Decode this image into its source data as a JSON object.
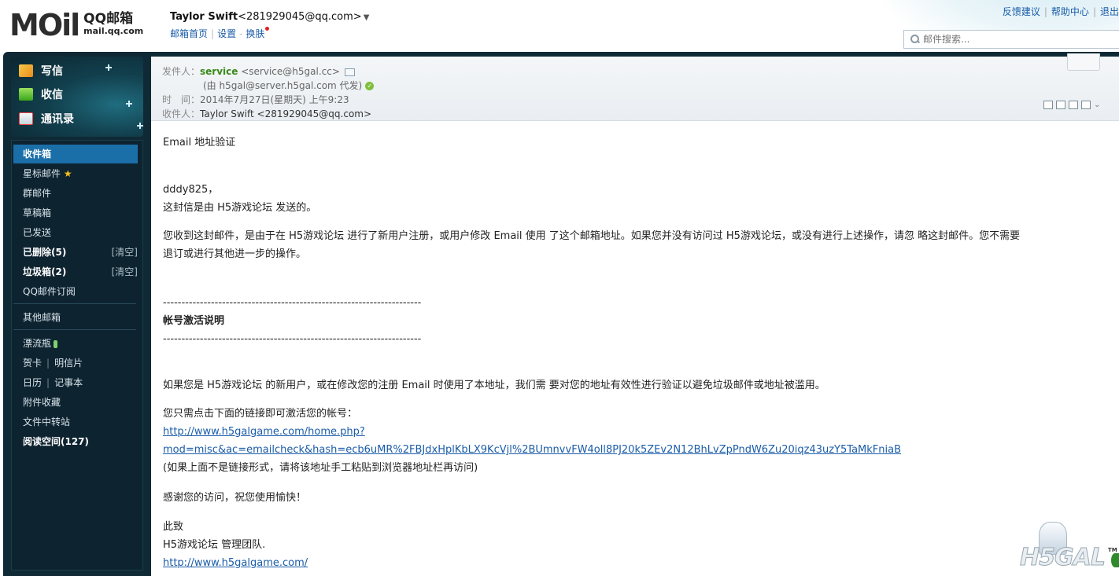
{
  "header": {
    "logo_mark": "MOil",
    "logo_cn": "QQ邮箱",
    "logo_url": "mail.qq.com",
    "user_name": "Taylor Swift",
    "user_email": "<281929045@qq.com>",
    "links": [
      "邮箱首页",
      "设置",
      "换肤"
    ],
    "top_links": [
      "反馈建议",
      "帮助中心",
      "退出"
    ],
    "search_placeholder": "邮件搜索..."
  },
  "quick_actions": [
    {
      "label": "写信",
      "icon": "pencil-icon"
    },
    {
      "label": "收信",
      "icon": "download-icon"
    },
    {
      "label": "通讯录",
      "icon": "contacts-icon"
    }
  ],
  "folders": {
    "inbox": "收件箱",
    "starred": "星标邮件",
    "star_glyph": "★",
    "group": "群邮件",
    "drafts": "草稿箱",
    "sent": "已发送",
    "deleted": "已删除(5)",
    "junk": "垃圾箱(2)",
    "clear": "[清空]",
    "subscription": "QQ邮件订阅",
    "other": "其他邮箱",
    "bottle": "漂流瓶",
    "card": "贺卡",
    "postcard": "明信片",
    "calendar": "日历",
    "notes": "记事本",
    "attachments": "附件收藏",
    "transfer": "文件中转站",
    "reading": "阅读空间(127)"
  },
  "mail": {
    "from_label": "发件人：",
    "sender_name": "service",
    "sender_addr": "<service@h5gal.cc>",
    "on_behalf": "(由 h5gal@server.h5gal.com 代发)",
    "time_label": "时　间：",
    "time_value": "2014年7月27日(星期天) 上午9:23",
    "to_label": "收件人：",
    "to_value": "Taylor Swift <281929045@qq.com>",
    "subject_line": "Email 地址验证",
    "greeting": "dddy825，",
    "sent_by": "这封信是由 H5游戏论坛 发送的。",
    "para1_a": "您收到这封邮件，是由于在 H5游戏论坛 进行了新用户注册，或用户修改 Email 使用 了这个邮箱地址。如果您并没有访问过 H5游戏论坛，或没有进行上述操作，请忽 略这封邮件。您不需要",
    "para1_b": "退订或进行其他进一步的操作。",
    "dash_line": "----------------------------------------------------------------------",
    "activation_title": "帐号激活说明",
    "para2": "如果您是 H5游戏论坛 的新用户，或在修改您的注册 Email 时使用了本地址，我们需 要对您的地址有效性进行验证以避免垃圾邮件或地址被滥用。",
    "click_hint": "您只需点击下面的链接即可激活您的帐号：",
    "link_part1": "http://www.h5galgame.com/home.php?",
    "link_part2": "mod=misc&ac=emailcheck&hash=ecb6uMR%2FBJdxHplKbLX9KcVjl%2BUmnvvFW4oll8PJ20k5ZEv2N12BhLvZpPndW6Zu20iqz43uzY5TaMkFniaB",
    "paste_hint": "(如果上面不是链接形式，请将该地址手工粘贴到浏览器地址栏再访问)",
    "thanks": "感谢您的访问，祝您使用愉快！",
    "regards": "此致",
    "team": "H5游戏论坛 管理团队.",
    "site_link": "http://www.h5galgame.com/"
  },
  "watermark": {
    "text": "H5GAL",
    "tm": "TM"
  }
}
